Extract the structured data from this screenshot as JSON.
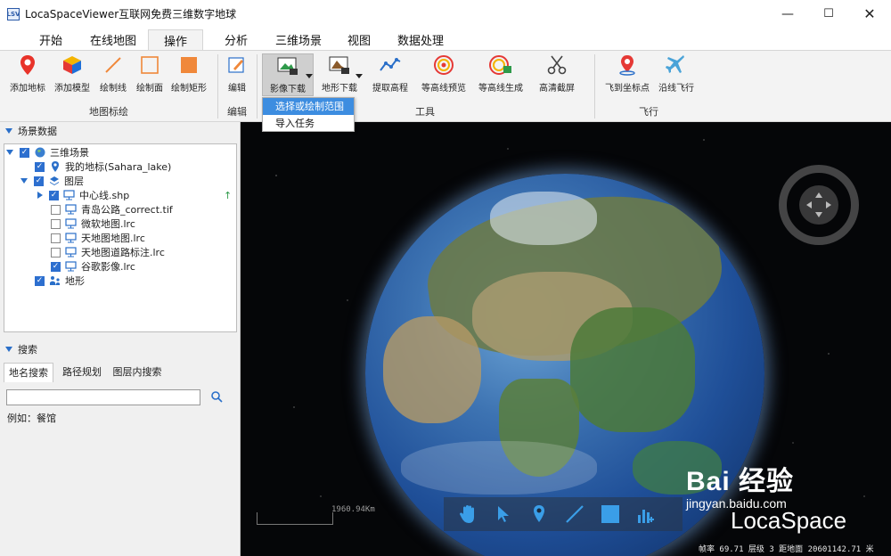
{
  "window": {
    "title": "LocaSpaceViewer互联网免费三维数字地球",
    "icon_text": "LSV",
    "controls": [
      "minimize-icon",
      "maximize-icon",
      "close-icon"
    ]
  },
  "tabs": [
    {
      "label": "开始"
    },
    {
      "label": "在线地图"
    },
    {
      "label": "操作",
      "active": true
    },
    {
      "label": "分析"
    },
    {
      "label": "三维场景"
    },
    {
      "label": "视图"
    },
    {
      "label": "数据处理"
    }
  ],
  "ribbon": {
    "groups": [
      {
        "label": "地图标绘"
      },
      {
        "label": "编辑"
      },
      {
        "label": "工具"
      },
      {
        "label": "飞行"
      }
    ],
    "buttons": [
      {
        "label": "添加地标",
        "icon": "pin-icon"
      },
      {
        "label": "添加模型",
        "icon": "cube-icon"
      },
      {
        "label": "绘制线",
        "icon": "line-icon"
      },
      {
        "label": "绘制面",
        "icon": "polygon-icon"
      },
      {
        "label": "绘制矩形",
        "icon": "rectangle-icon"
      },
      {
        "label": "编辑",
        "icon": "edit-icon"
      },
      {
        "label": "影像下载",
        "icon": "image-download-icon",
        "pressed": true
      },
      {
        "label": "地形下载",
        "icon": "terrain-download-icon"
      },
      {
        "label": "提取高程",
        "icon": "elevation-icon"
      },
      {
        "label": "等高线预览",
        "icon": "contour-preview-icon"
      },
      {
        "label": "等高线生成",
        "icon": "contour-generate-icon"
      },
      {
        "label": "高清截屏",
        "icon": "scissors-icon"
      },
      {
        "label": "飞到坐标点",
        "icon": "fly-to-point-icon"
      },
      {
        "label": "沿线飞行",
        "icon": "plane-icon"
      }
    ]
  },
  "dropdown": {
    "items": [
      {
        "label": "选择或绘制范围",
        "highlighted": true
      },
      {
        "label": "导入任务"
      }
    ]
  },
  "scene_panel": {
    "title": "场景数据",
    "tree": [
      {
        "label": "三维场景",
        "checked": true,
        "expand": "down",
        "icon": "globe-icon"
      },
      {
        "label": "我的地标(Sahara_lake)",
        "checked": true,
        "icon": "pin-icon"
      },
      {
        "label": "图层",
        "checked": true,
        "expand": "down",
        "icon": "layers-icon"
      },
      {
        "label": "中心线.shp",
        "checked": true,
        "expand": "right",
        "icon": "monitor-icon",
        "badge": "up-arrow-icon"
      },
      {
        "label": "青岛公路_correct.tif",
        "checked": false,
        "icon": "monitor-icon"
      },
      {
        "label": "微软地图.lrc",
        "checked": false,
        "icon": "monitor-icon"
      },
      {
        "label": "天地图地图.lrc",
        "checked": false,
        "icon": "monitor-icon"
      },
      {
        "label": "天地图道路标注.lrc",
        "checked": false,
        "icon": "monitor-icon"
      },
      {
        "label": "谷歌影像.lrc",
        "checked": true,
        "icon": "monitor-icon"
      },
      {
        "label": "地形",
        "checked": true,
        "icon": "terrain-icon"
      }
    ]
  },
  "search_panel": {
    "title": "搜索",
    "tabs": [
      {
        "label": "地名搜索",
        "active": true
      },
      {
        "label": "路径规划"
      },
      {
        "label": "图层内搜索"
      }
    ],
    "input_value": "",
    "hint": "例如：餐馆"
  },
  "viewport": {
    "scale_text": "1960.94Km",
    "status_text": "帧率 69.71  层级 3  距地面 20601142.71 米",
    "tools": [
      "hand-icon",
      "pointer-icon",
      "pin-icon",
      "line-icon",
      "square-icon",
      "chart-add-icon"
    ]
  },
  "watermark": {
    "big": "Bai 经验",
    "sub": "jingyan.baidu.com",
    "brand": "LocaSpace"
  },
  "colors": {
    "accent": "#2a6fc9",
    "highlight": "#3d8de0",
    "ribbon_bg": "#f3f3f3",
    "space": "#050608"
  }
}
